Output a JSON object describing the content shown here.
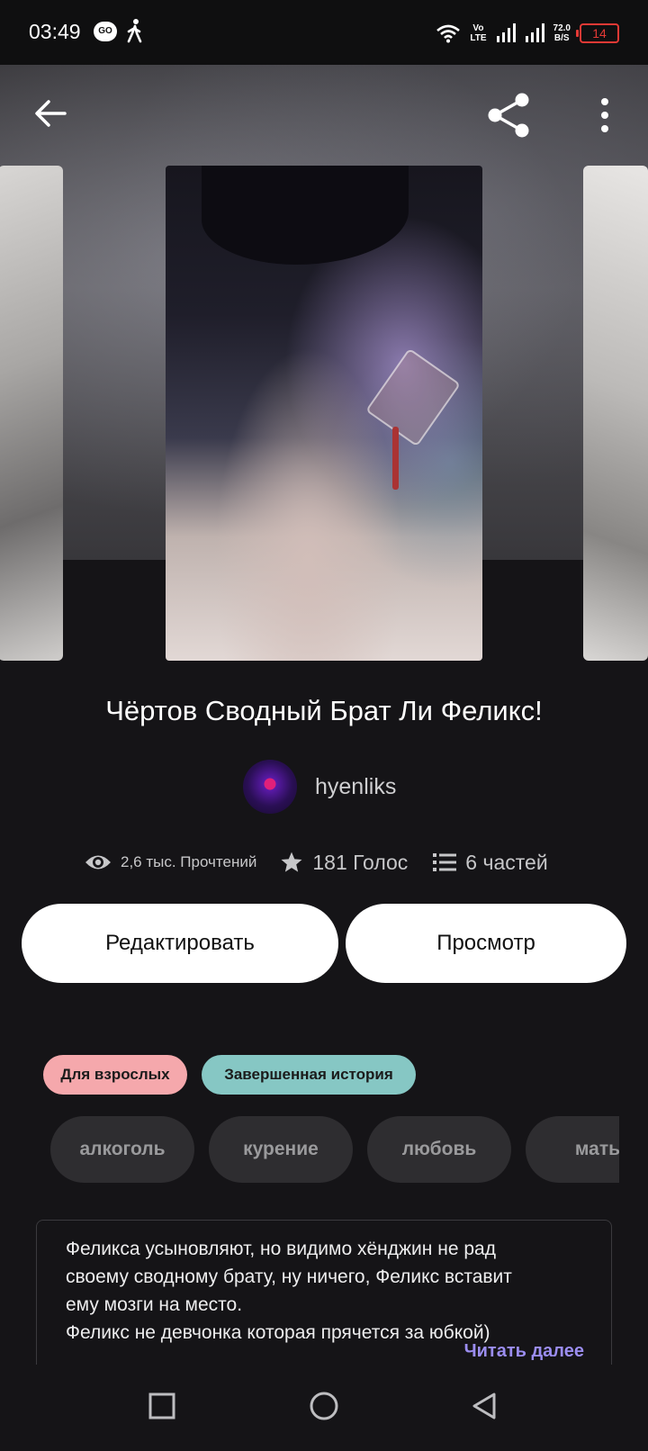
{
  "status_bar": {
    "time": "03:49",
    "go_badge": "GO",
    "volte_top": "Vo",
    "volte_bottom": "LTE",
    "speed_value": "72.0",
    "speed_unit": "B/S",
    "battery_level": "14",
    "battery_color": "#e53935"
  },
  "story": {
    "title": "Чёртов Сводный Брат Ли Феликс!",
    "author": "hyenliks",
    "reads": "2,6 тыс. Прочтений",
    "votes": "181 Голос",
    "parts": "6 частей"
  },
  "actions": {
    "edit_label": "Редактировать",
    "view_label": "Просмотр"
  },
  "badges": {
    "mature": "Для взрослых",
    "complete": "Завершенная история",
    "mature_color": "#f5a8ac",
    "complete_color": "#86c7c4"
  },
  "tags": [
    "алкоголь",
    "курение",
    "любовь",
    "мать"
  ],
  "description": {
    "lines": [
      "Феликса усыновляют, но видимо хёнджин не рад",
      "своему сводному брату, ну ничего, Феликс вставит",
      "ему мозги на место.",
      "Феликс не девчонка которая прячется за юбкой)"
    ],
    "read_more": "Читать далее"
  },
  "icons": {
    "back": "arrow-left-icon",
    "share": "share-icon",
    "more": "more-vertical-icon",
    "reads": "eye-icon",
    "votes": "star-icon",
    "parts": "list-icon"
  },
  "accent_color": "#9b8df0"
}
